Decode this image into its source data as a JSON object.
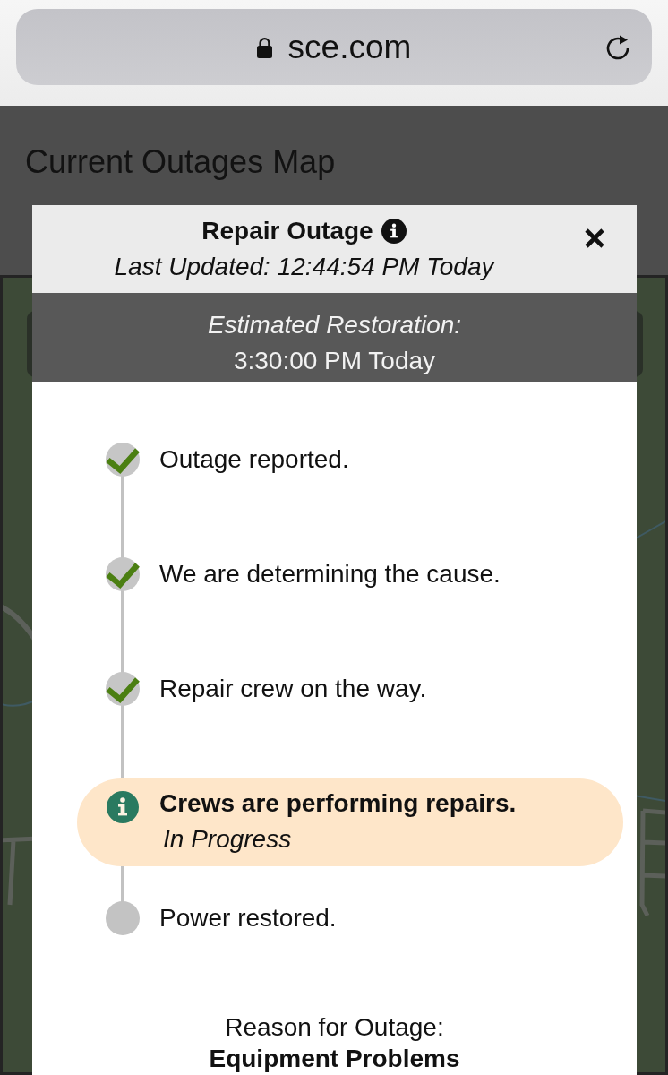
{
  "browser": {
    "url": "sce.com",
    "secure": true
  },
  "page": {
    "title": "Current Outages Map"
  },
  "modal": {
    "title": "Repair Outage",
    "updated": "Last Updated: 12:44:54 PM Today",
    "estimate": {
      "label": "Estimated Restoration:",
      "value": "3:30:00 PM Today"
    },
    "steps": [
      {
        "label": "Outage reported.",
        "kind": "done"
      },
      {
        "label": "We are determining the cause.",
        "kind": "done"
      },
      {
        "label": "Repair crew on the way.",
        "kind": "done"
      },
      {
        "label": "Crews are performing repairs.",
        "kind": "current",
        "status": "In Progress"
      },
      {
        "label": "Power restored.",
        "kind": "pending"
      }
    ],
    "reason": {
      "label": "Reason for Outage:",
      "value": "Equipment Problems"
    }
  }
}
